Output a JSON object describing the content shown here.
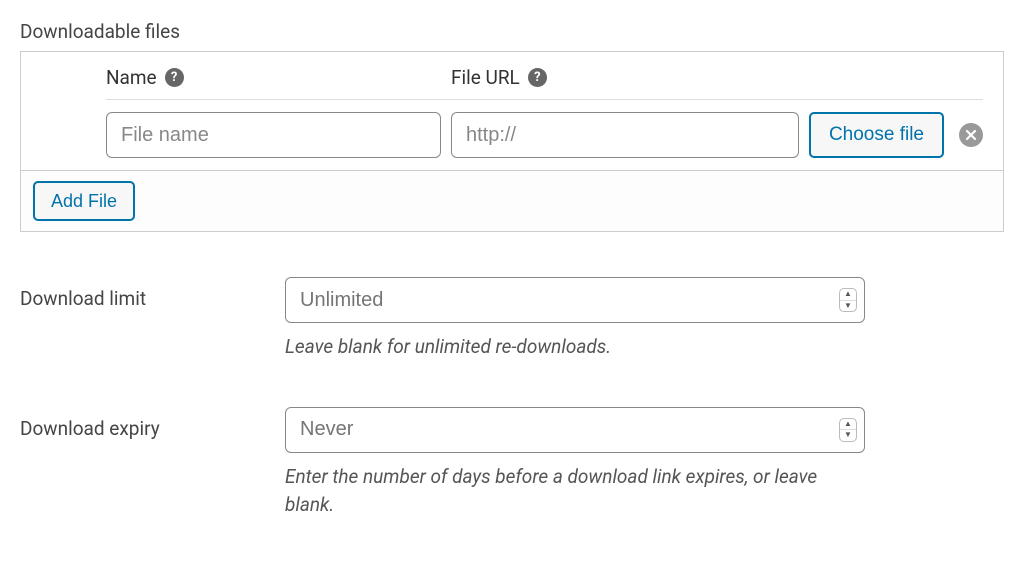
{
  "section": {
    "title": "Downloadable files"
  },
  "columns": {
    "name_label": "Name",
    "url_label": "File URL"
  },
  "row": {
    "name_placeholder": "File name",
    "url_placeholder": "http://",
    "choose_label": "Choose file"
  },
  "footer": {
    "add_label": "Add File"
  },
  "download_limit": {
    "label": "Download limit",
    "placeholder": "Unlimited",
    "help": "Leave blank for unlimited re-downloads."
  },
  "download_expiry": {
    "label": "Download expiry",
    "placeholder": "Never",
    "help": "Enter the number of days before a download link expires, or leave blank."
  }
}
